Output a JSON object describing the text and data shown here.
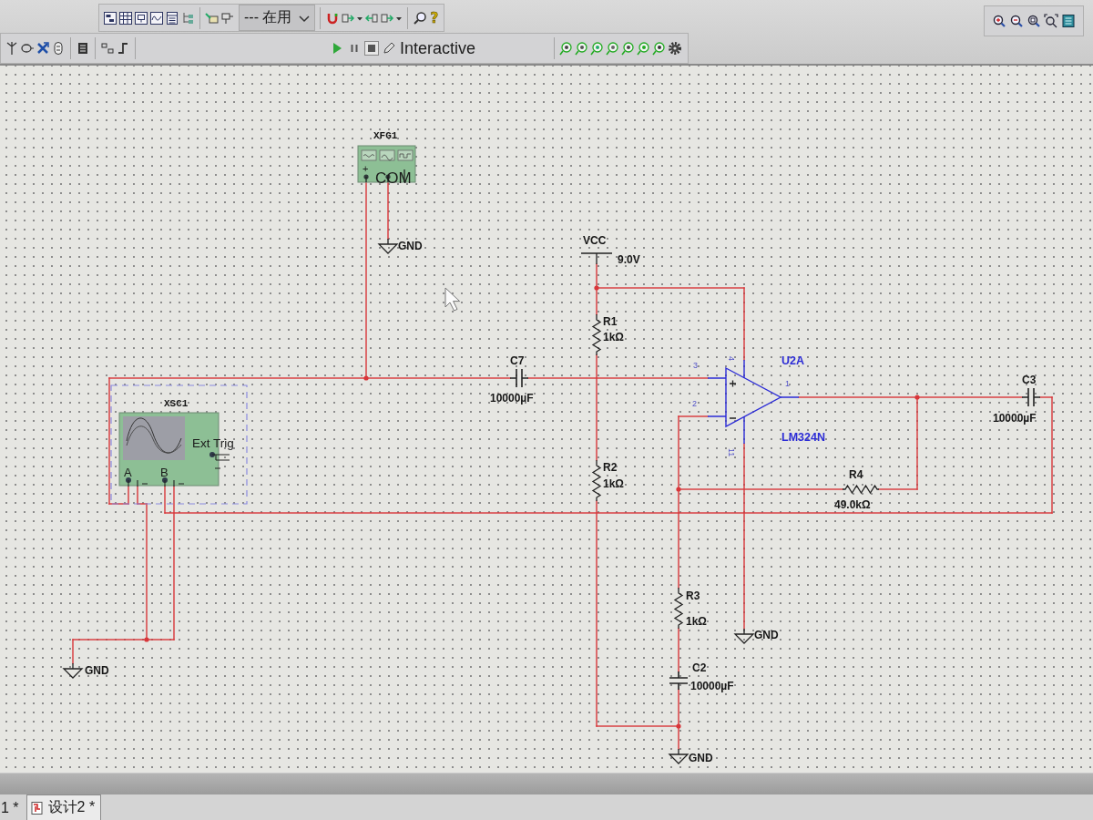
{
  "toolbar": {
    "component_list": {
      "value": "--- 在用"
    },
    "help_glyph": "?",
    "simulation_mode": "Interactive"
  },
  "schematic": {
    "function_generator": {
      "ref": "XFG1",
      "terminals": [
        "+",
        "COM"
      ]
    },
    "supply": {
      "name": "VCC",
      "voltage": "9.0V"
    },
    "resistors": [
      {
        "ref": "R1",
        "value": "1kΩ"
      },
      {
        "ref": "R2",
        "value": "1kΩ"
      },
      {
        "ref": "R3",
        "value": "1kΩ"
      },
      {
        "ref": "R4",
        "value": "49.0kΩ"
      }
    ],
    "capacitors": [
      {
        "ref": "C7",
        "value": "10000µF"
      },
      {
        "ref": "C3",
        "value": "10000µF"
      },
      {
        "ref": "C2",
        "value": "10000µF"
      }
    ],
    "opamp": {
      "ref": "U2A",
      "part": "LM324N",
      "pins": [
        "3",
        "2",
        "4",
        "11",
        "1"
      ]
    },
    "oscilloscope": {
      "ref": "XSC1",
      "channels": [
        "A",
        "B"
      ],
      "trigger": "Ext Trig"
    },
    "grounds": [
      {
        "label": "GND"
      },
      {
        "label": "GND"
      },
      {
        "label": "GND"
      },
      {
        "label": "GND"
      }
    ]
  },
  "tabs": [
    {
      "label": "1 *",
      "selected": false,
      "icon": false
    },
    {
      "label": "设计2 *",
      "selected": true,
      "icon": true
    }
  ]
}
